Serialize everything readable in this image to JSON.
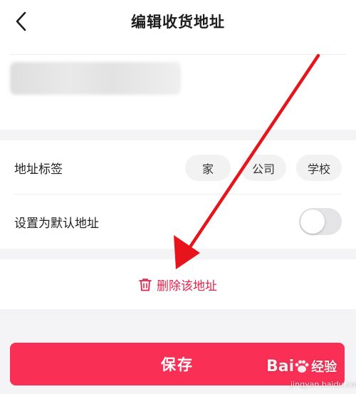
{
  "header": {
    "title": "编辑收货地址",
    "back_icon": "chevron-left-icon"
  },
  "address": {
    "blurred_note": "redacted"
  },
  "tags": {
    "label": "地址标签",
    "options": [
      "家",
      "公司",
      "学校"
    ]
  },
  "default_address": {
    "label": "设置为默认地址",
    "enabled": false
  },
  "delete": {
    "label": "删除该地址",
    "icon": "trash-icon"
  },
  "save": {
    "label": "保存"
  },
  "watermark": {
    "brand": "Bai",
    "brand2": "经验",
    "url": "jingyan.baidu.com"
  },
  "colors": {
    "accent": "#fa2f55",
    "delete_text": "#e8224a",
    "annotation_arrow": "#e8141c"
  }
}
